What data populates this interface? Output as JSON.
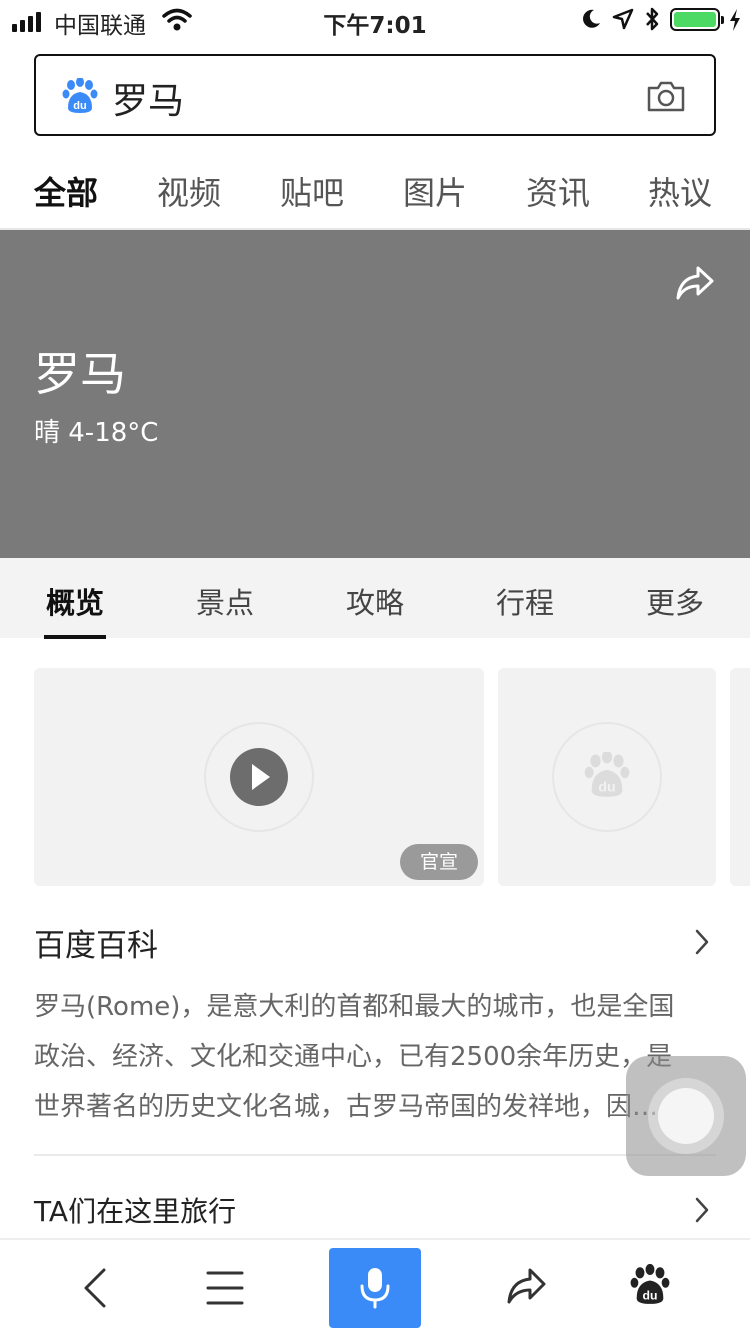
{
  "status": {
    "carrier": "中国联通",
    "time": "下午7:01",
    "battery_level": 1.0
  },
  "search": {
    "query": "罗马",
    "logo_icon": "baidu-paw-icon",
    "camera_icon": "camera-icon"
  },
  "tabs": [
    {
      "label": "全部",
      "active": true
    },
    {
      "label": "视频"
    },
    {
      "label": "贴吧"
    },
    {
      "label": "图片"
    },
    {
      "label": "资讯"
    },
    {
      "label": "热议"
    }
  ],
  "hero": {
    "city": "罗马",
    "weather": "晴 4-18°C",
    "share_icon": "share-icon"
  },
  "subtabs": [
    {
      "label": "概览",
      "active": true
    },
    {
      "label": "景点"
    },
    {
      "label": "攻略"
    },
    {
      "label": "行程"
    },
    {
      "label": "更多"
    }
  ],
  "media": {
    "tag": "官宣"
  },
  "baike": {
    "title": "百度百科",
    "lines": [
      "罗马(Rome)，是意大利的首都和最大的城市，也是全国",
      "政治、经济、文化和交通中心，已有2500余年历史，是",
      "世界著名的历史文化名城，古罗马帝国的发祥地，因…"
    ]
  },
  "travel": {
    "title": "TA们在这里旅行"
  },
  "colors": {
    "accent": "#3a8af7",
    "hero_bg": "#7a7a7a",
    "battery": "#4cd964"
  }
}
